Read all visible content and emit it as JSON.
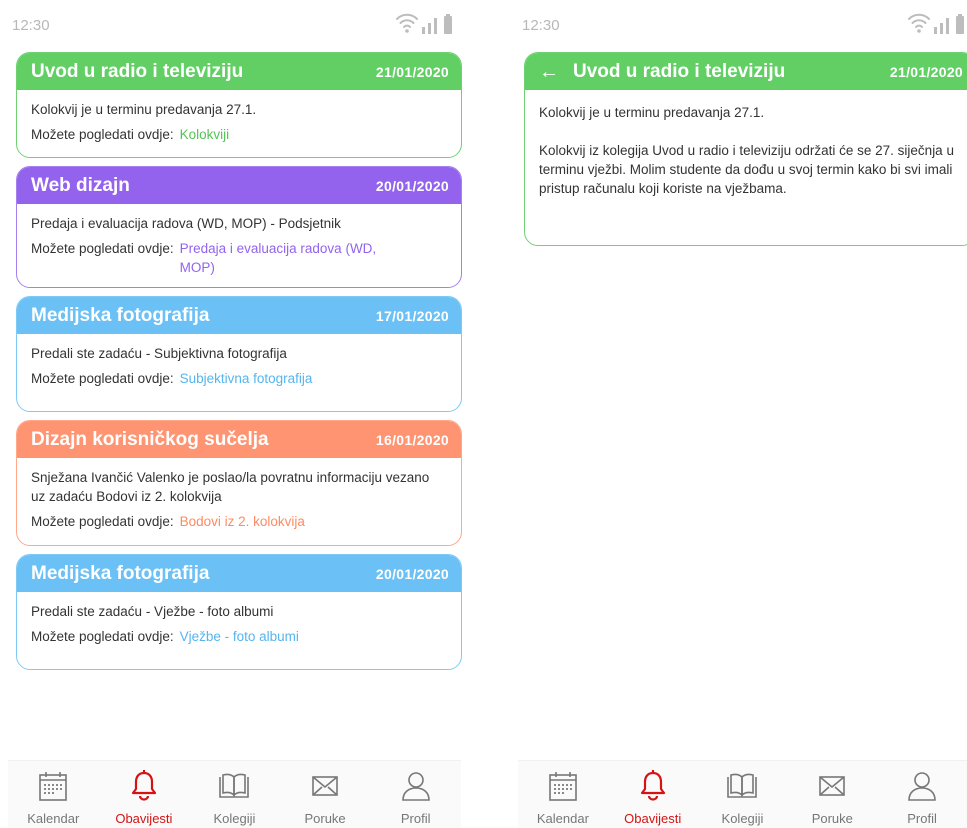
{
  "list_screen": {
    "status": {
      "time": "12:30"
    },
    "cards": [
      {
        "title": "Uvod u radio i televiziju",
        "date": "21/01/2020",
        "message": "Kolokvij je u terminu predavanja 27.1.",
        "link_label": "Možete pogledati ovdje:",
        "link_text": "Kolokviji",
        "color": "#62cf65"
      },
      {
        "title": "Web dizajn",
        "date": "20/01/2020",
        "message": "Predaja i evaluacija radova (WD, MOP) - Podsjetnik",
        "link_label": "Možete pogledati ovdje:",
        "link_text": "Predaja i evaluacija radova (WD, MOP)",
        "color": "#9363ee"
      },
      {
        "title": "Medijska fotografija",
        "date": "17/01/2020",
        "message": "Predali ste zadaću - Subjektivna fotografija",
        "link_label": "Možete pogledati ovdje:",
        "link_text": "Subjektivna fotografija",
        "color": "#6bc1f5"
      },
      {
        "title": "Dizajn korisničkog sučelja",
        "date": "16/01/2020",
        "message": "Snježana Ivančić Valenko je poslao/la povratnu informaciju vezano uz zadaću Bodovi iz 2. kolokvija",
        "link_label": "Možete pogledati ovdje:",
        "link_text": "Bodovi iz 2. kolokvija",
        "color": "#ff9472"
      },
      {
        "title": "Medijska fotografija",
        "date": "20/01/2020",
        "message": "Predali ste zadaću - Vježbe - foto albumi",
        "link_label": "Možete pogledati ovdje:",
        "link_text": "Vježbe - foto albumi",
        "color": "#6bc1f5"
      }
    ]
  },
  "detail_screen": {
    "status": {
      "time": "12:30"
    },
    "title": "Uvod u radio i televiziju",
    "date": "21/01/2020",
    "back_icon": "arrow-left-icon",
    "paragraph_1": "Kolokvij je u terminu predavanja 27.1.",
    "paragraph_2": "Kolokvij iz kolegija Uvod u radio i televiziju održati će se 27. siječnja u terminu vježbi. Molim studente da dođu u svoj termin kako bi svi imali pristup računalu koji koriste na vježbama."
  },
  "navbar": {
    "items": [
      {
        "label": "Kalendar",
        "icon": "calendar-icon",
        "active": false
      },
      {
        "label": "Obavijesti",
        "icon": "bell-icon",
        "active": true
      },
      {
        "label": "Kolegiji",
        "icon": "book-icon",
        "active": false
      },
      {
        "label": "Poruke",
        "icon": "envelope-icon",
        "active": false
      },
      {
        "label": "Profil",
        "icon": "user-icon",
        "active": false
      }
    ],
    "active_color": "#d41414"
  }
}
